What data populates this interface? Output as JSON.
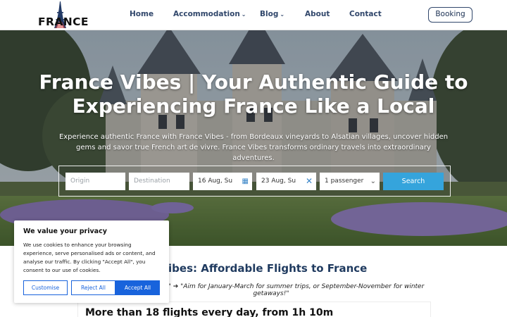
{
  "logo": {
    "text": "FRANCE",
    "icon": "eiffel-tower-icon"
  },
  "nav": {
    "home": "Home",
    "accommodation": "Accommodation",
    "blog": "Blog",
    "about": "About",
    "contact": "Contact",
    "chevron": "⌄"
  },
  "booking_button": "Booking",
  "hero": {
    "title": "France Vibes | Your Authentic Guide to Experiencing France Like a Local",
    "subtitle": "Experience authentic France with France Vibes - from Bordeaux vineyards to Alsatian villages, uncover hidden gems and savor true French art de vivre. France Vibes transforms ordinary travels into extraordinary adventures."
  },
  "search": {
    "origin_placeholder": "Origin",
    "destination_placeholder": "Destination",
    "depart_date": "16 Aug, Su",
    "return_date": "23 Aug, Su",
    "passengers": "1 passenger",
    "search_label": "Search",
    "calendar_icon": "calendar-icon",
    "clear_icon": "close-icon",
    "chevron": "⌄"
  },
  "content": {
    "section_title": "h France Vibes: Affordable Flights to France",
    "tip": "k cheap flights?\" ➔ \"Aim for January-March for summer trips, or September-November for winter getaways!\"",
    "card_title": "More than 18 flights every day, from 1h 10m"
  },
  "cookie": {
    "title": "We value your privacy",
    "text": "We use cookies to enhance your browsing experience, serve personalised ads or content, and analyse our traffic. By clicking \"Accept All\", you consent to our use of cookies.",
    "customise": "Customise",
    "reject": "Reject All",
    "accept": "Accept All"
  },
  "colors": {
    "nav_text": "#31476b",
    "search_button": "#35a4dc",
    "cookie_accent": "#1863dc",
    "section_title": "#1f3a5f"
  }
}
